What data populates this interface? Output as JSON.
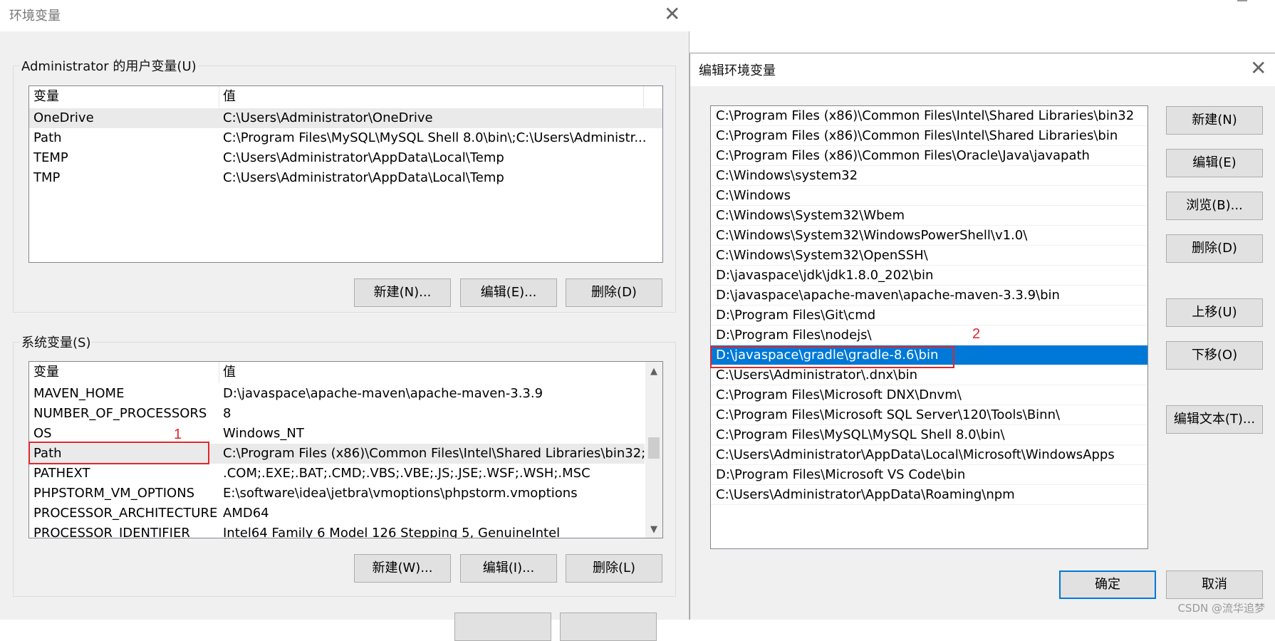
{
  "env_dialog": {
    "title": "环境变量",
    "user_group_label": "Administrator 的用户变量(U)",
    "system_group_label": "系统变量(S)",
    "col_var": "变量",
    "col_val": "值",
    "user_vars": [
      {
        "name": "OneDrive",
        "value": "C:\\Users\\Administrator\\OneDrive"
      },
      {
        "name": "Path",
        "value": "C:\\Program Files\\MySQL\\MySQL Shell 8.0\\bin\\;C:\\Users\\Administr..."
      },
      {
        "name": "TEMP",
        "value": "C:\\Users\\Administrator\\AppData\\Local\\Temp"
      },
      {
        "name": "TMP",
        "value": "C:\\Users\\Administrator\\AppData\\Local\\Temp"
      }
    ],
    "system_vars": [
      {
        "name": "MAVEN_HOME",
        "value": "D:\\javaspace\\apache-maven\\apache-maven-3.3.9"
      },
      {
        "name": "NUMBER_OF_PROCESSORS",
        "value": "8"
      },
      {
        "name": "OS",
        "value": "Windows_NT"
      },
      {
        "name": "Path",
        "value": "C:\\Program Files (x86)\\Common Files\\Intel\\Shared Libraries\\bin32;..."
      },
      {
        "name": "PATHEXT",
        "value": ".COM;.EXE;.BAT;.CMD;.VBS;.VBE;.JS;.JSE;.WSF;.WSH;.MSC"
      },
      {
        "name": "PHPSTORM_VM_OPTIONS",
        "value": "E:\\software\\idea\\jetbra\\vmoptions\\phpstorm.vmoptions"
      },
      {
        "name": "PROCESSOR_ARCHITECTURE",
        "value": "AMD64"
      },
      {
        "name": "PROCESSOR_IDENTIFIER",
        "value": "Intel64 Family 6 Model 126 Stepping 5, GenuineIntel"
      }
    ],
    "user_buttons": {
      "new": "新建(N)...",
      "edit": "编辑(E)...",
      "delete": "删除(D)"
    },
    "system_buttons": {
      "new": "新建(W)...",
      "edit": "编辑(I)...",
      "delete": "删除(L)"
    },
    "annotation_1": "1"
  },
  "path_dialog": {
    "title": "编辑环境变量",
    "entries": [
      "C:\\Program Files (x86)\\Common Files\\Intel\\Shared Libraries\\bin32",
      "C:\\Program Files (x86)\\Common Files\\Intel\\Shared Libraries\\bin",
      "C:\\Program Files (x86)\\Common Files\\Oracle\\Java\\javapath",
      "C:\\Windows\\system32",
      "C:\\Windows",
      "C:\\Windows\\System32\\Wbem",
      "C:\\Windows\\System32\\WindowsPowerShell\\v1.0\\",
      "C:\\Windows\\System32\\OpenSSH\\",
      "D:\\javaspace\\jdk\\jdk1.8.0_202\\bin",
      "D:\\javaspace\\apache-maven\\apache-maven-3.3.9\\bin",
      "D:\\Program Files\\Git\\cmd",
      "D:\\Program Files\\nodejs\\",
      "D:\\javaspace\\gradle\\gradle-8.6\\bin",
      "C:\\Users\\Administrator\\.dnx\\bin",
      "C:\\Program Files\\Microsoft DNX\\Dnvm\\",
      "C:\\Program Files\\Microsoft SQL Server\\120\\Tools\\Binn\\",
      "C:\\Program Files\\MySQL\\MySQL Shell 8.0\\bin\\",
      "C:\\Users\\Administrator\\AppData\\Local\\Microsoft\\WindowsApps",
      "D:\\Program Files\\Microsoft VS Code\\bin",
      "C:\\Users\\Administrator\\AppData\\Roaming\\npm"
    ],
    "selected_index": 12,
    "buttons": {
      "new": "新建(N)",
      "edit": "编辑(E)",
      "browse": "浏览(B)...",
      "delete": "删除(D)",
      "move_up": "上移(U)",
      "move_down": "下移(O)",
      "edit_text": "编辑文本(T)...",
      "ok": "确定",
      "cancel": "取消"
    },
    "annotation_2": "2"
  },
  "watermark": "CSDN @流华追梦",
  "colors": {
    "selection": "#0078d7",
    "annotation": "#e0262a"
  }
}
